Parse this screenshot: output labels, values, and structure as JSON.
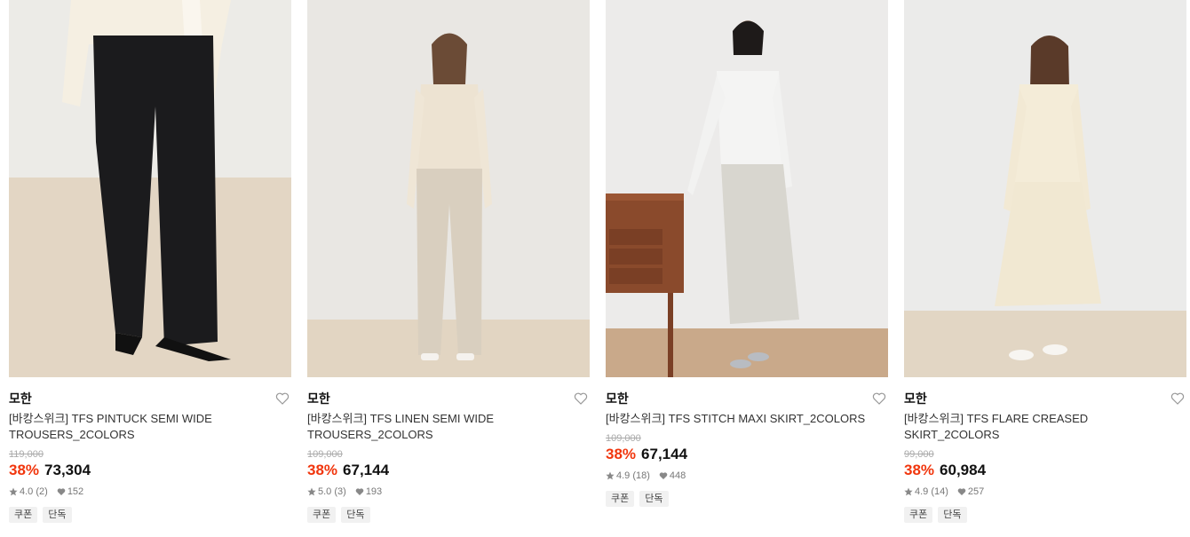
{
  "products": [
    {
      "brand": "모한",
      "name": "[바캉스위크] TFS PINTUCK SEMI WIDE TROUSERS_2COLORS",
      "original_price": "119,000",
      "discount": "38%",
      "price": "73,304",
      "rating": "4.0",
      "review_count": "(2)",
      "likes": "152",
      "tags": [
        "쿠폰",
        "단독"
      ]
    },
    {
      "brand": "모한",
      "name": "[바캉스위크] TFS LINEN SEMI WIDE TROUSERS_2COLORS",
      "original_price": "109,000",
      "discount": "38%",
      "price": "67,144",
      "rating": "5.0",
      "review_count": "(3)",
      "likes": "193",
      "tags": [
        "쿠폰",
        "단독"
      ]
    },
    {
      "brand": "모한",
      "name": "[바캉스위크] TFS STITCH MAXI SKIRT_2COLORS",
      "original_price": "109,000",
      "discount": "38%",
      "price": "67,144",
      "rating": "4.9",
      "review_count": "(18)",
      "likes": "448",
      "tags": [
        "쿠폰",
        "단독"
      ]
    },
    {
      "brand": "모한",
      "name": "[바캉스위크] TFS FLARE CREASED SKIRT_2COLORS",
      "original_price": "99,000",
      "discount": "38%",
      "price": "60,984",
      "rating": "4.9",
      "review_count": "(14)",
      "likes": "257",
      "tags": [
        "쿠폰",
        "단독"
      ]
    }
  ],
  "colors": {
    "discount": "#f1360d",
    "tag_bg": "#f1f1f1"
  },
  "icons": {
    "like": "heart-outline-icon",
    "rating": "star-icon",
    "likes": "heart-filled-icon"
  }
}
